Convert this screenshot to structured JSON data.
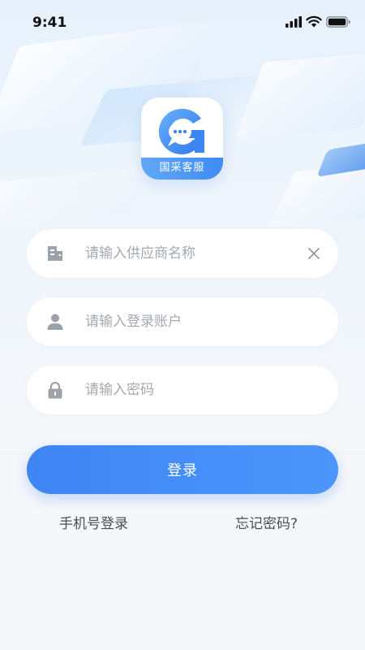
{
  "status_bar": {
    "time": "9:41",
    "icons": [
      "signal-icon",
      "wifi-icon",
      "battery-icon"
    ]
  },
  "app": {
    "logo_label": "国采客服",
    "logo_icon": "chat-bubble-g-icon"
  },
  "form": {
    "supplier": {
      "placeholder": "请输入供应商名称",
      "value": "",
      "icon": "building-icon"
    },
    "account": {
      "placeholder": "请输入登录账户",
      "value": "",
      "icon": "user-icon"
    },
    "password": {
      "placeholder": "请输入密码",
      "value": "",
      "icon": "lock-icon"
    },
    "login_label": "登录"
  },
  "links": {
    "phone_login": "手机号登录",
    "forgot_password": "忘记密码?"
  },
  "colors": {
    "primary": "#4088F5",
    "icon_gray": "#9da1aa",
    "background": "#f5f7fa"
  }
}
